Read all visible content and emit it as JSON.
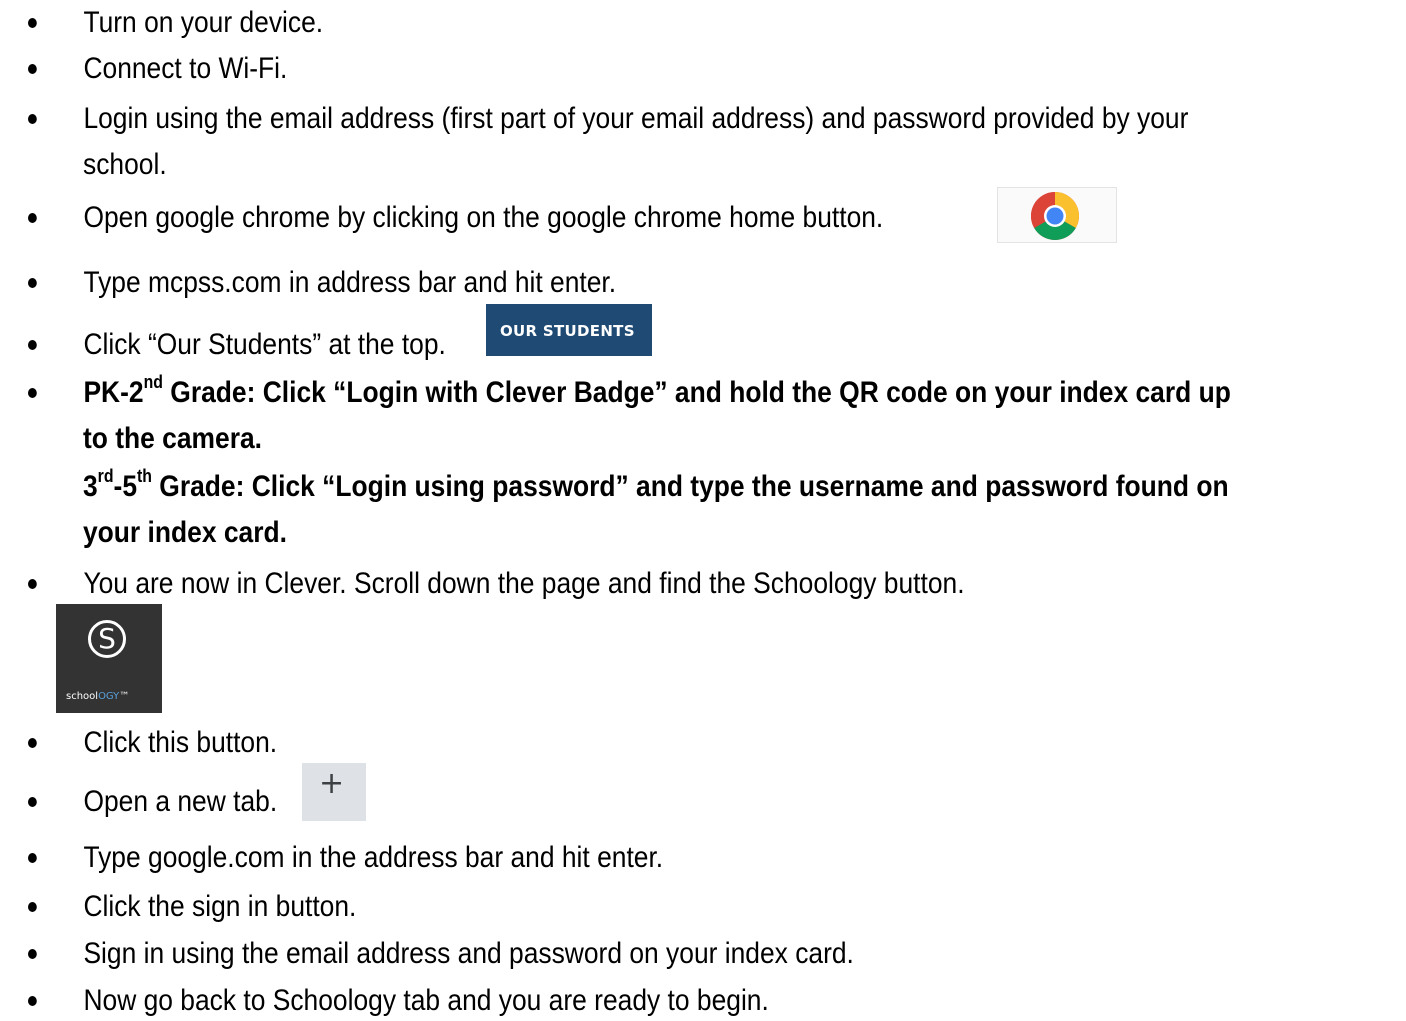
{
  "steps": [
    {
      "text": "Turn on your device."
    },
    {
      "text": "Connect to Wi-Fi."
    },
    {
      "line1": "Login using the email address (first part of your email address) and password provided by your",
      "line2": "school."
    },
    {
      "text": "Open google chrome by clicking on the google chrome home button."
    },
    {
      "text": "Type mcpss.com in address bar and hit enter."
    },
    {
      "text": "Click “Our Students” at the top."
    },
    {
      "pk_prefix": "PK-2",
      "pk_sup": "nd",
      "pk_line1": " Grade: Click “Login with Clever Badge” and hold the QR code on your index card up",
      "pk_line2": "to the camera.",
      "g3_num": "3",
      "g3_sup": "rd",
      "g3_dash": "-5",
      "g3_sup2": "th",
      "g3_line1": " Grade: Click “Login using password” and type the username and password found on",
      "g3_line2": "your index card."
    },
    {
      "text": "You are now in Clever. Scroll down the page and find the Schoology button."
    },
    {
      "text": "Click this button."
    },
    {
      "text": "Open a new tab."
    },
    {
      "text": "Type google.com in the address bar and hit enter."
    },
    {
      "text": "Click the sign in button."
    },
    {
      "text": "Sign in using the email address and password on your index card."
    },
    {
      "text": "Now go back to Schoology tab and you are ready to begin."
    }
  ],
  "buttons": {
    "chrome_icon": "chrome-icon",
    "our_students_label": "OUR STUDENTS",
    "schoology_letter": "S",
    "schoology_word_a": "school",
    "schoology_word_b": "OGY",
    "schoology_trademark": "™",
    "newtab_symbol": "+"
  },
  "colors": {
    "our_students_bg": "#1f4a73",
    "schoology_bg": "#333333",
    "schoology_accent": "#5aa0d8",
    "newtab_bg": "#dee1e6"
  }
}
